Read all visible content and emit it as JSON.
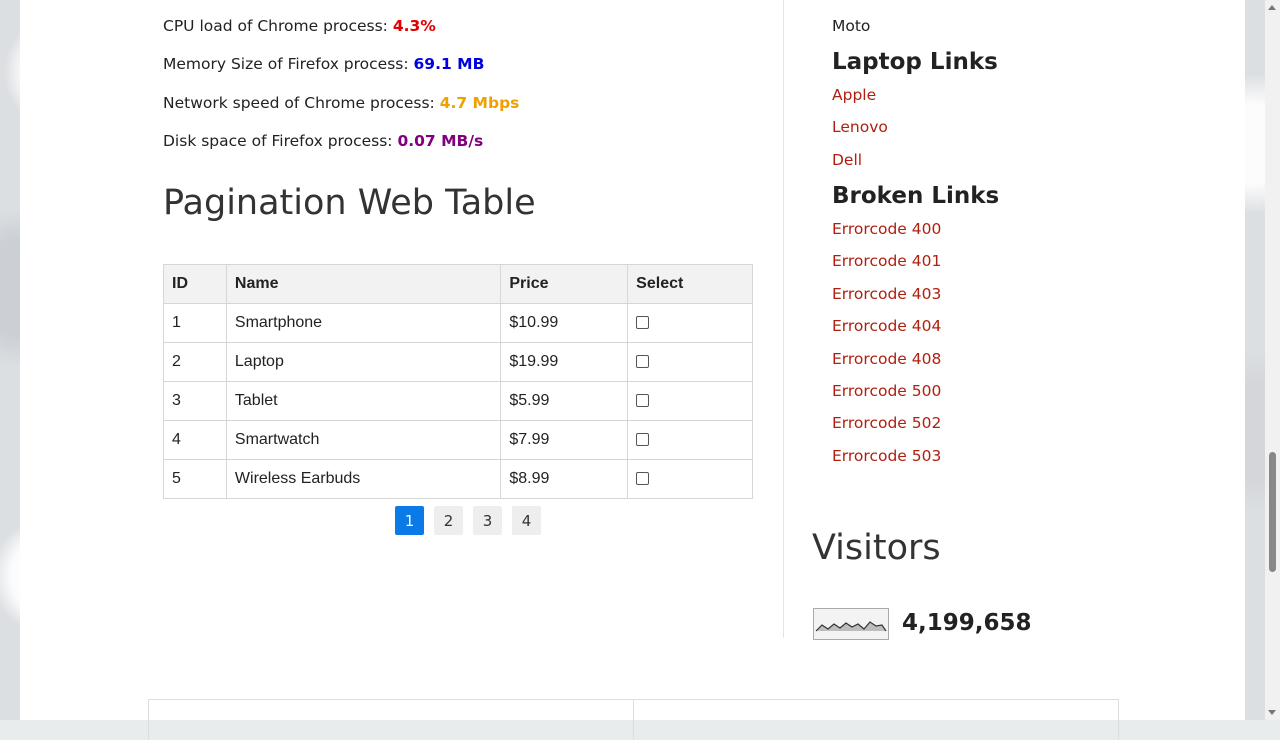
{
  "info": [
    {
      "label": "CPU load of Chrome process: ",
      "value": "4.3%",
      "color": "#e00000"
    },
    {
      "label": "Memory Size of Firefox process: ",
      "value": "69.1 MB",
      "color": "#0000e0"
    },
    {
      "label": "Network speed of Chrome process: ",
      "value": "4.7 Mbps",
      "color": "#f0a000"
    },
    {
      "label": "Disk space of Firefox process: ",
      "value": "0.07 MB/s",
      "color": "#800080"
    }
  ],
  "pagination": {
    "title": "Pagination Web Table",
    "headers": [
      "ID",
      "Name",
      "Price",
      "Select"
    ],
    "rows": [
      {
        "id": "1",
        "name": "Smartphone",
        "price": "$10.99"
      },
      {
        "id": "2",
        "name": "Laptop",
        "price": "$19.99"
      },
      {
        "id": "3",
        "name": "Tablet",
        "price": "$5.99"
      },
      {
        "id": "4",
        "name": "Smartwatch",
        "price": "$7.99"
      },
      {
        "id": "5",
        "name": "Wireless Earbuds",
        "price": "$8.99"
      }
    ],
    "pages": [
      "1",
      "2",
      "3",
      "4"
    ],
    "active_page": "1"
  },
  "sidebar": {
    "moto": "Moto",
    "laptop_heading": "Laptop Links",
    "laptop_links": [
      "Apple",
      "Lenovo",
      "Dell"
    ],
    "broken_heading": "Broken Links",
    "broken_links": [
      "Errorcode 400",
      "Errorcode 401",
      "Errorcode 403",
      "Errorcode 404",
      "Errorcode 408",
      "Errorcode 500",
      "Errorcode 502",
      "Errorcode 503"
    ],
    "visitors_heading": "Visitors",
    "visitor_count": "4,199,658"
  }
}
